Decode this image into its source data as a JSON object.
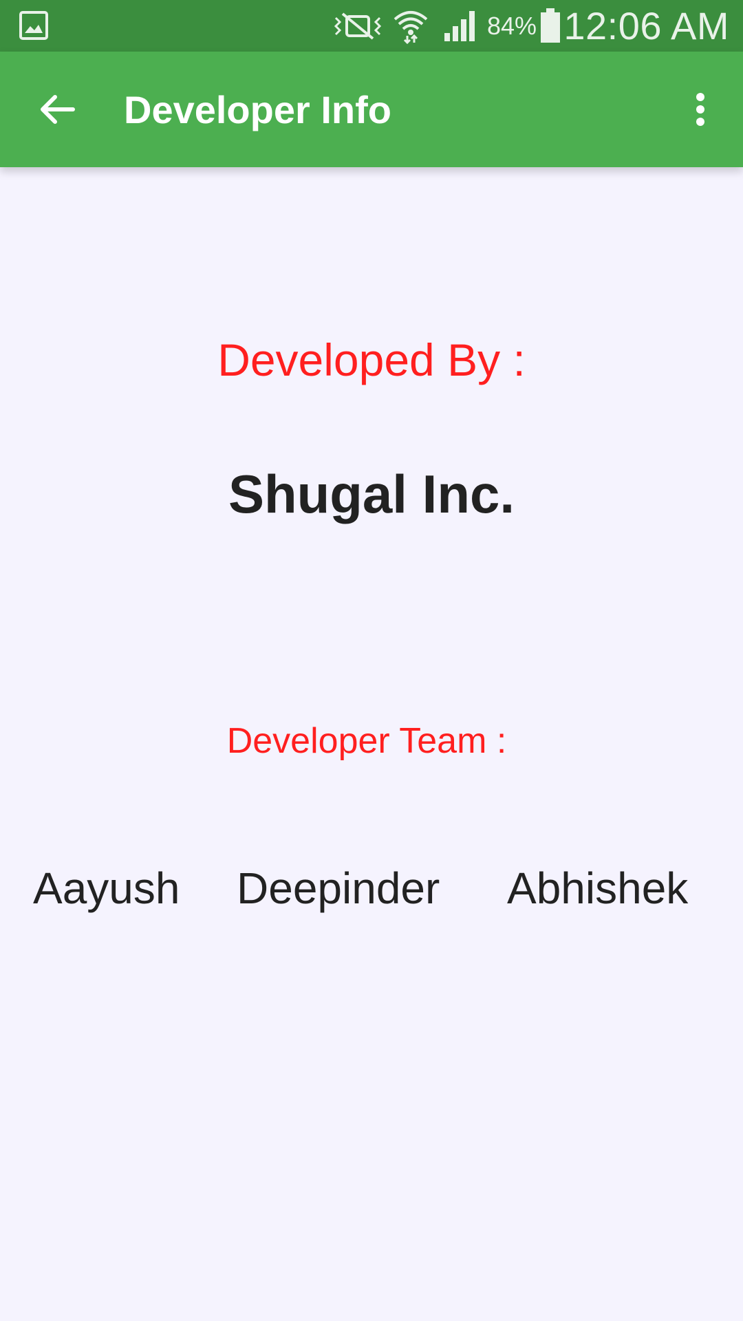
{
  "status_bar": {
    "icons": [
      "gallery-icon",
      "mute-vibrate-icon",
      "wifi-icon",
      "signal-icon",
      "battery-icon"
    ],
    "battery_percent": "84%",
    "time": "12:06 AM",
    "background_color": "#3B8E3E"
  },
  "app_bar": {
    "back_icon": "arrow-back-icon",
    "title": "Developer Info",
    "overflow_icon": "more-vert-icon",
    "background_color": "#4CAF50"
  },
  "content": {
    "developed_by_label": "Developed By :",
    "company_name": "Shugal Inc.",
    "team_label": "Developer Team :",
    "team_members": [
      "Aayush",
      "Deepinder",
      "Abhishek"
    ],
    "label_color": "#FF1F1F",
    "background_color": "#F5F3FE"
  }
}
